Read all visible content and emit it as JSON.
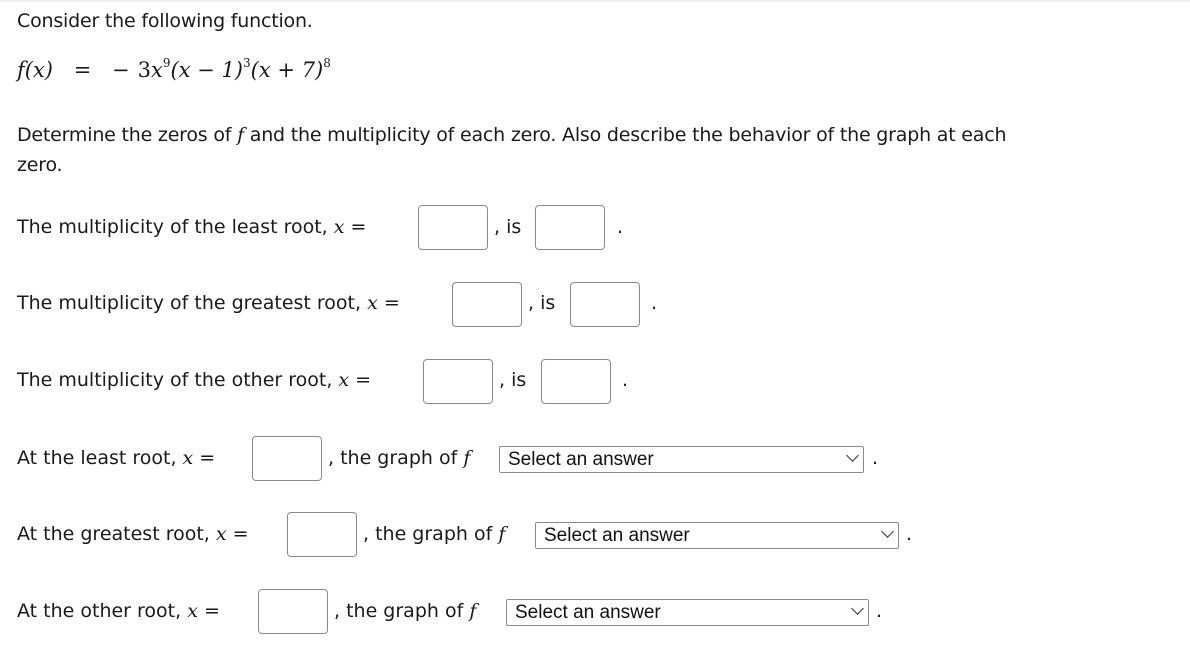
{
  "intro": "Consider the following function.",
  "formula": {
    "lhs": "f(x)",
    "eq": "=",
    "neg": "−",
    "coef": "3",
    "var": "x",
    "exp1": "9",
    "factor2": "(x − 1)",
    "exp2": "3",
    "factor3": "(x + 7)",
    "exp3": "8"
  },
  "instructions": {
    "line1_a": "Determine the zeros of ",
    "f": "f",
    "line1_b": " and the multiplicity of each zero. Also describe the behavior of the graph at each",
    "line2": "zero."
  },
  "multiplicity_rows": [
    {
      "label": "The multiplicity of the least root, ",
      "x_eq": "x =",
      "sep": ", is",
      "end": ".",
      "root_value": "",
      "multiplicity_value": ""
    },
    {
      "label": "The multiplicity of the greatest root, ",
      "x_eq": "x =",
      "sep": ", is",
      "end": ".",
      "root_value": "",
      "multiplicity_value": ""
    },
    {
      "label": "The multiplicity of the other root, ",
      "x_eq": "x =",
      "sep": ", is",
      "end": ".",
      "root_value": "",
      "multiplicity_value": ""
    }
  ],
  "behavior_rows": [
    {
      "label": "At the least root, ",
      "x_eq": "x =",
      "mid": ", the graph of ",
      "f": "f",
      "select": "Select an answer",
      "end": ".",
      "root_value": ""
    },
    {
      "label": "At the greatest root, ",
      "x_eq": "x =",
      "mid": ", the graph of ",
      "f": "f",
      "select": "Select an answer",
      "end": ".",
      "root_value": ""
    },
    {
      "label": "At the other root, ",
      "x_eq": "x =",
      "mid": ", the graph of ",
      "f": "f",
      "select": "Select an answer",
      "end": ".",
      "root_value": ""
    }
  ]
}
